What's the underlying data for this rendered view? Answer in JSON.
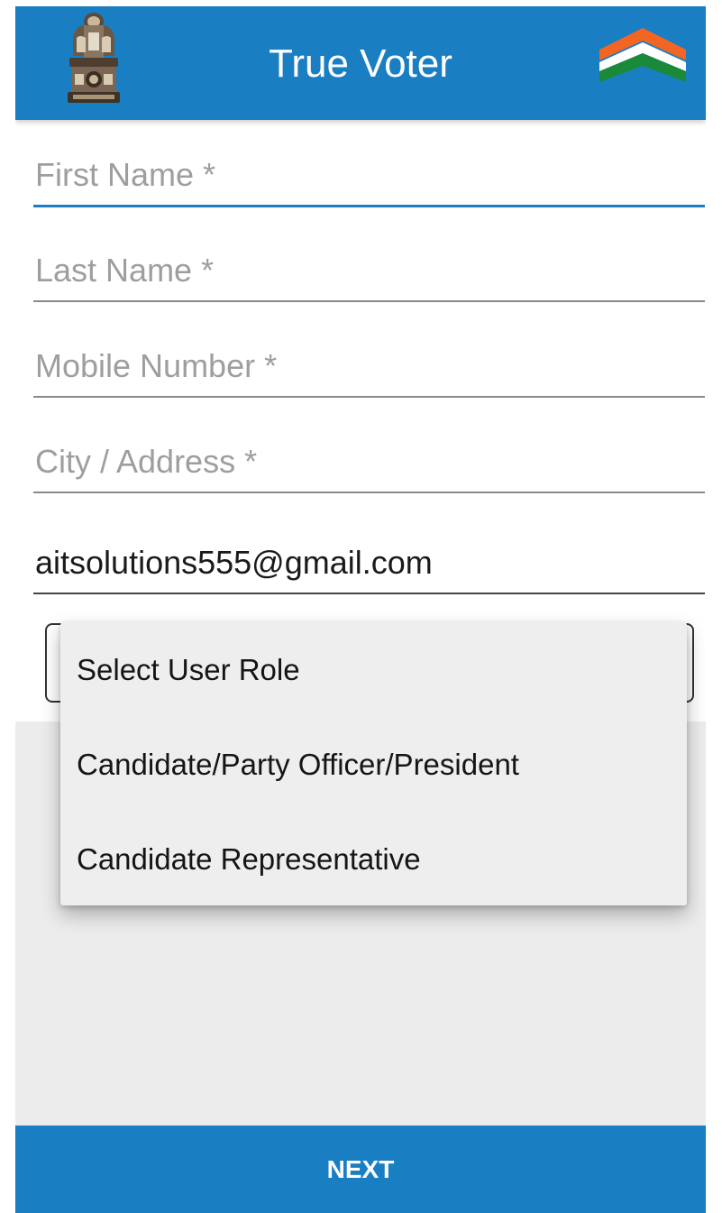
{
  "app": {
    "title": "True Voter",
    "brand_color": "#1a7ec3",
    "left_icon": "national-emblem-icon",
    "right_icon": "tricolor-chevron-icon"
  },
  "form": {
    "first_name": {
      "placeholder": "First Name *",
      "value": ""
    },
    "last_name": {
      "placeholder": "Last Name *",
      "value": ""
    },
    "mobile_number": {
      "placeholder": "Mobile Number *",
      "value": ""
    },
    "city_address": {
      "placeholder": "City / Address *",
      "value": ""
    },
    "email": {
      "value": "aitsolutions555@gmail.com"
    }
  },
  "role_dropdown": {
    "options": [
      "Select User Role",
      "Candidate/Party Officer/President",
      "Candidate Representative"
    ]
  },
  "footer": {
    "next_label": "NEXT"
  }
}
